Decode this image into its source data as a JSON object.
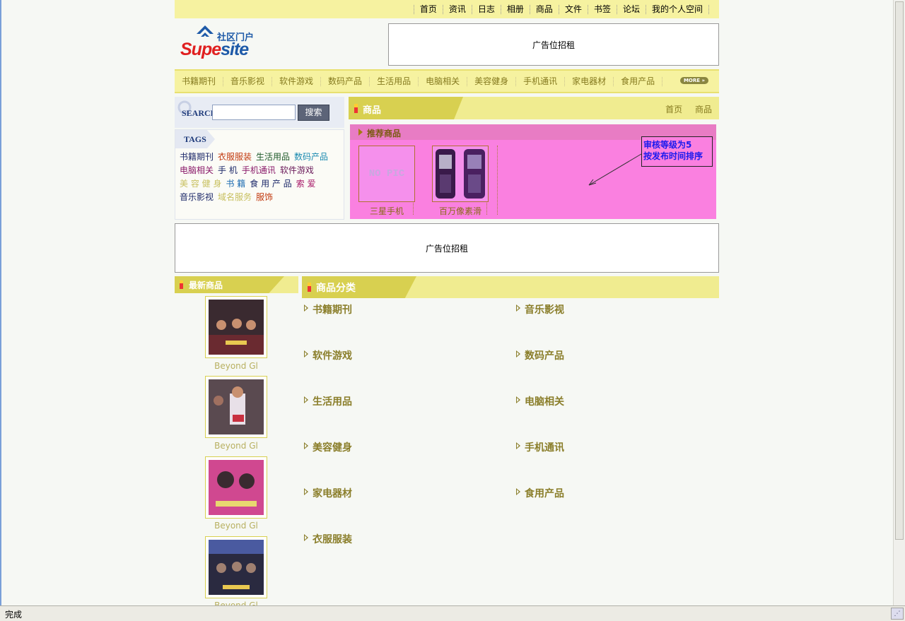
{
  "topnav": {
    "items": [
      "首页",
      "资讯",
      "日志",
      "相册",
      "商品",
      "文件",
      "书签",
      "论坛",
      "我的个人空间"
    ]
  },
  "logo": {
    "cn": "社区门户",
    "en_main": "Supe",
    "en_tail": "site"
  },
  "ads": {
    "top": "广告位招租",
    "middle": "广告位招租"
  },
  "catbar": {
    "items": [
      "书籍期刊",
      "音乐影视",
      "软件游戏",
      "数码产品",
      "生活用品",
      "电脑相关",
      "美容健身",
      "手机通讯",
      "家电器材",
      "食用产品"
    ],
    "more": "MORE »"
  },
  "search": {
    "label": "SEARCH",
    "placeholder": "",
    "button": "搜索"
  },
  "tags": {
    "title": "TAGS",
    "items": [
      {
        "text": "书籍期刊",
        "color": "#1e2a6a"
      },
      {
        "text": "衣服服装",
        "color": "#c23a10"
      },
      {
        "text": "生活用品",
        "color": "#1e5a2a"
      },
      {
        "text": "数码产品",
        "color": "#1a8ab0"
      },
      {
        "text": "电脑相关",
        "color": "#8a1a6a"
      },
      {
        "text": "手 机",
        "color": "#1e2a6a"
      },
      {
        "text": "手机通讯",
        "color": "#8a1a6a"
      },
      {
        "text": "软件游戏",
        "color": "#6a1a5a"
      },
      {
        "text": "美 容 健 身",
        "color": "#c8c060"
      },
      {
        "text": "书 籍",
        "color": "#1a6ab0"
      },
      {
        "text": "食 用 产 品",
        "color": "#1e2a6a"
      },
      {
        "text": "索 爱",
        "color": "#a81a6a"
      },
      {
        "text": "音乐影视",
        "color": "#1e2a6a"
      },
      {
        "text": "域名服务",
        "color": "#c8c060"
      },
      {
        "text": "服饰",
        "color": "#c23a10"
      }
    ]
  },
  "goods": {
    "title": "商品",
    "crumbs": [
      "首页",
      "商品"
    ],
    "recommended": {
      "title": "推荐商品",
      "items": [
        {
          "caption": "三星手机",
          "nopic": "NO PIC"
        },
        {
          "caption": "百万像素滑"
        }
      ],
      "annotation": [
        "审核等级为5",
        "按发布时间排序"
      ]
    }
  },
  "latest": {
    "title": "最新商品",
    "items": [
      {
        "caption": "Beyond Gl"
      },
      {
        "caption": "Beyond Gl"
      },
      {
        "caption": "Beyond Gl"
      },
      {
        "caption": "Beyond Gl"
      }
    ]
  },
  "categories": {
    "title": "商品分类",
    "items": [
      "书籍期刊",
      "音乐影视",
      "软件游戏",
      "数码产品",
      "生活用品",
      "电脑相关",
      "美容健身",
      "手机通讯",
      "家电器材",
      "食用产品",
      "衣服服装"
    ]
  },
  "status": {
    "text": "完成"
  }
}
